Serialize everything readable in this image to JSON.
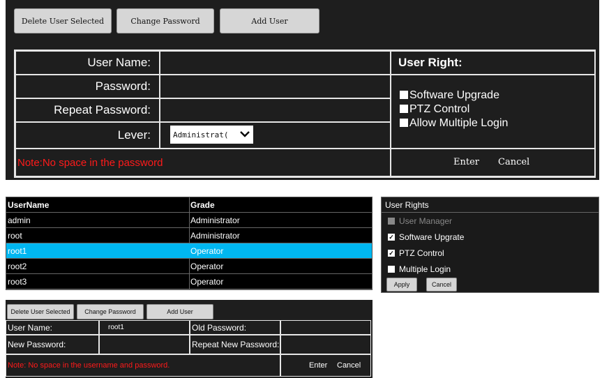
{
  "top": {
    "buttons": {
      "delete": "Delete User Selected",
      "change": "Change Password",
      "add": "Add User"
    },
    "labels": {
      "username": "User Name:",
      "password": "Password:",
      "repeat": "Repeat Password:",
      "lever": "Lever:"
    },
    "rights": {
      "title": "User Right:",
      "items": [
        {
          "label": "Software Upgrade",
          "checked": false
        },
        {
          "label": "PTZ Control",
          "checked": false
        },
        {
          "label": "Allow Multiple Login",
          "checked": false
        }
      ]
    },
    "note": "Note:No space in the password",
    "actions": {
      "enter": "Enter",
      "cancel": "Cancel"
    },
    "select": {
      "value": "Administrat("
    }
  },
  "users": {
    "headers": [
      "UserName",
      "Grade"
    ],
    "rows": [
      {
        "name": "admin",
        "grade": "Administrator",
        "selected": false
      },
      {
        "name": "root",
        "grade": "Administrator",
        "selected": false
      },
      {
        "name": "root1",
        "grade": "Operator",
        "selected": true
      },
      {
        "name": "root2",
        "grade": "Operator",
        "selected": false
      },
      {
        "name": "root3",
        "grade": "Operator",
        "selected": false
      }
    ]
  },
  "rights_panel": {
    "title": "User Rights",
    "items": [
      {
        "label": "User Manager",
        "checked": false,
        "disabled": true
      },
      {
        "label": "Software Upgrate",
        "checked": true,
        "disabled": false
      },
      {
        "label": "PTZ Control",
        "checked": true,
        "disabled": false
      },
      {
        "label": "Multiple Login",
        "checked": false,
        "disabled": false
      }
    ],
    "apply": "Apply",
    "cancel": "Cancel"
  },
  "bottom": {
    "buttons": {
      "delete": "Delete User Selected",
      "change": "Change Password",
      "add": "Add User"
    },
    "labels": {
      "username": "User Name:",
      "old": "Old Password:",
      "new": "New Password:",
      "repeat": "Repeat New Password:"
    },
    "username_value": "root1",
    "note": "Note: No space in the username and password.",
    "enter": "Enter",
    "cancel": "Cancel"
  },
  "colors": {
    "selected": "#00b7f1",
    "note": "#ff1a1a",
    "panel": "#1e1e1e"
  }
}
